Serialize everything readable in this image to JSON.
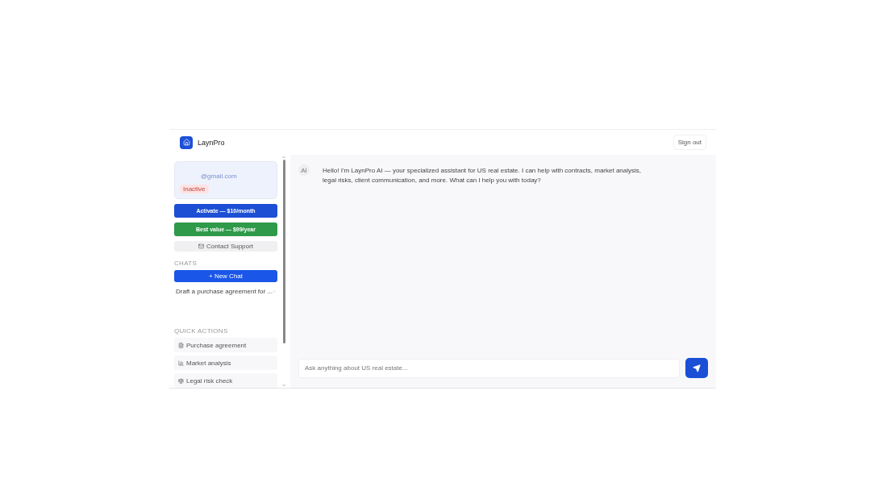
{
  "header": {
    "brand": "LaynPro",
    "sign_out": "Sign out"
  },
  "account": {
    "email": "@gmail.com",
    "status": "Inactive",
    "active": false
  },
  "plans": [
    {
      "label": "Activate — $10/month",
      "kind": "monthly"
    },
    {
      "label": "Best value — $99/year",
      "kind": "yearly"
    }
  ],
  "support": "Contact Support",
  "chats": {
    "heading": "CHATS",
    "new_chat": "+ New Chat",
    "items": [
      {
        "title": "Draft a purchase agreement for ...",
        "selected": false
      }
    ]
  },
  "quick_actions": {
    "heading": "QUICK ACTIONS",
    "items": [
      {
        "label": "Purchase agreement",
        "kind": "document"
      },
      {
        "label": "Market analysis",
        "kind": "chart"
      },
      {
        "label": "Legal risk check",
        "kind": "legal"
      }
    ]
  },
  "messages": [
    {
      "sender": "AI",
      "text": "Hello! I'm LaynPro AI — your specialized assistant for US real estate. I can help with contracts, market analysis, legal risks, client communication, and more. What can I help you with today?"
    }
  ],
  "composer": {
    "placeholder": "Ask anything about US real estate..."
  }
}
